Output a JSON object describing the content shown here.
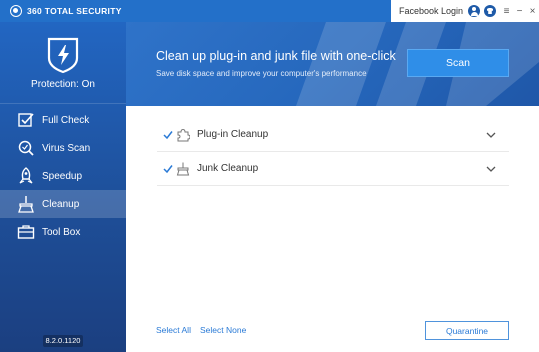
{
  "app": {
    "logo_text": "360 TOTAL SECURITY",
    "version": "8.2.0.1120"
  },
  "titlebar": {
    "login_label": "Facebook Login",
    "icons": [
      "user-icon",
      "shirt-icon",
      "menu-icon",
      "minimize-icon",
      "close-icon"
    ],
    "menu_glyph": "≡",
    "minimize_glyph": "−",
    "close_glyph": "×"
  },
  "sidebar": {
    "protection_status": "Protection: On",
    "items": [
      {
        "label": "Full Check",
        "icon": "full-check-icon",
        "active": false
      },
      {
        "label": "Virus Scan",
        "icon": "virus-scan-icon",
        "active": false
      },
      {
        "label": "Speedup",
        "icon": "speedup-icon",
        "active": false
      },
      {
        "label": "Cleanup",
        "icon": "cleanup-icon",
        "active": true
      },
      {
        "label": "Tool Box",
        "icon": "toolbox-icon",
        "active": false
      }
    ]
  },
  "banner": {
    "title": "Clean up plug-in and junk file with one-click",
    "subtitle": "Save disk space and improve your computer's performance",
    "scan_label": "Scan"
  },
  "cleanup_items": [
    {
      "label": "Plug-in Cleanup",
      "checked": true,
      "icon": "puzzle-icon"
    },
    {
      "label": "Junk Cleanup",
      "checked": true,
      "icon": "broom-icon"
    }
  ],
  "footer": {
    "select_all": "Select All",
    "select_none": "Select None",
    "quarantine": "Quarantine"
  },
  "colors": {
    "accent": "#2370c9",
    "sidebar": "#1f4f9a",
    "link": "#2a7ad6",
    "scan_button": "#2f8ee8"
  }
}
